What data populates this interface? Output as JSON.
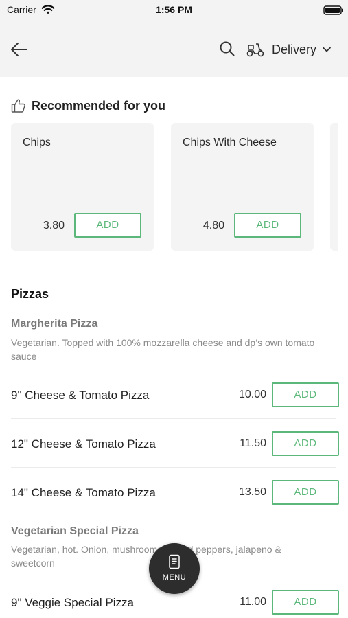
{
  "status_bar": {
    "carrier": "Carrier",
    "time": "1:56 PM"
  },
  "header": {
    "back_icon": "arrow-left-icon",
    "search_icon": "search-icon",
    "delivery_icon": "scooter-icon",
    "delivery_label": "Delivery",
    "dropdown_icon": "chevron-down-icon"
  },
  "recommended": {
    "icon": "thumbs-up-icon",
    "title": "Recommended for you",
    "items": [
      {
        "name": "Chips",
        "price": "3.80",
        "add_label": "ADD"
      },
      {
        "name": "Chips With Cheese",
        "price": "4.80",
        "add_label": "ADD"
      }
    ]
  },
  "menu": {
    "category": "Pizzas",
    "groups": [
      {
        "title": "Margherita Pizza",
        "description": "Vegetarian. Topped with 100% mozzarella cheese and dp’s own tomato sauce",
        "items": [
          {
            "name": "9\" Cheese & Tomato Pizza",
            "price": "10.00",
            "add_label": "ADD"
          },
          {
            "name": "12\" Cheese & Tomato Pizza",
            "price": "11.50",
            "add_label": "ADD"
          },
          {
            "name": "14\" Cheese & Tomato Pizza",
            "price": "13.50",
            "add_label": "ADD"
          }
        ]
      },
      {
        "title": "Vegetarian Special Pizza",
        "description": "Vegetarian, hot. Onion, mushrooms, mixed peppers, jalapeno & sweetcorn",
        "items": [
          {
            "name": "9\" Veggie Special Pizza",
            "price": "11.00",
            "add_label": "ADD"
          }
        ]
      }
    ]
  },
  "fab": {
    "label": "MENU",
    "icon": "menu-card-icon"
  },
  "colors": {
    "accent_green": "#5cb87a",
    "header_bg": "#f3f3f3",
    "card_bg": "#f4f4f4",
    "fab_bg": "#2d2d2d"
  }
}
